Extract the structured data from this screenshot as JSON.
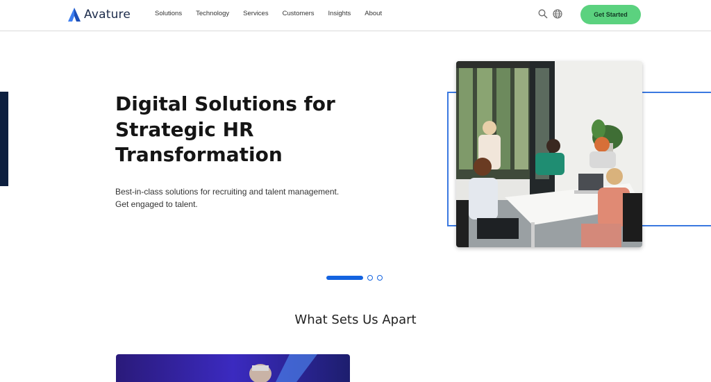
{
  "brand": {
    "name": "Avature",
    "accent": "#1463e0",
    "cta_color": "#5bd27f"
  },
  "nav": {
    "items": [
      {
        "label": "Solutions",
        "name": "nav-solutions"
      },
      {
        "label": "Technology",
        "name": "nav-technology"
      },
      {
        "label": "Services",
        "name": "nav-services"
      },
      {
        "label": "Customers",
        "name": "nav-customers"
      },
      {
        "label": "Insights",
        "name": "nav-insights"
      },
      {
        "label": "About",
        "name": "nav-about"
      }
    ],
    "icons": [
      "search-icon",
      "globe-icon"
    ],
    "cta_label": "Get Started"
  },
  "hero": {
    "title_line1": "Digital Solutions for",
    "title_line2": "Strategic HR",
    "title_line3": "Transformation",
    "subtitle_line1": "Best-in-class solutions for recruiting and talent management.",
    "subtitle_line2": "Get engaged to talent."
  },
  "carousel": {
    "slides": 3,
    "active": 1
  },
  "section": {
    "title": "What Sets Us Apart"
  }
}
